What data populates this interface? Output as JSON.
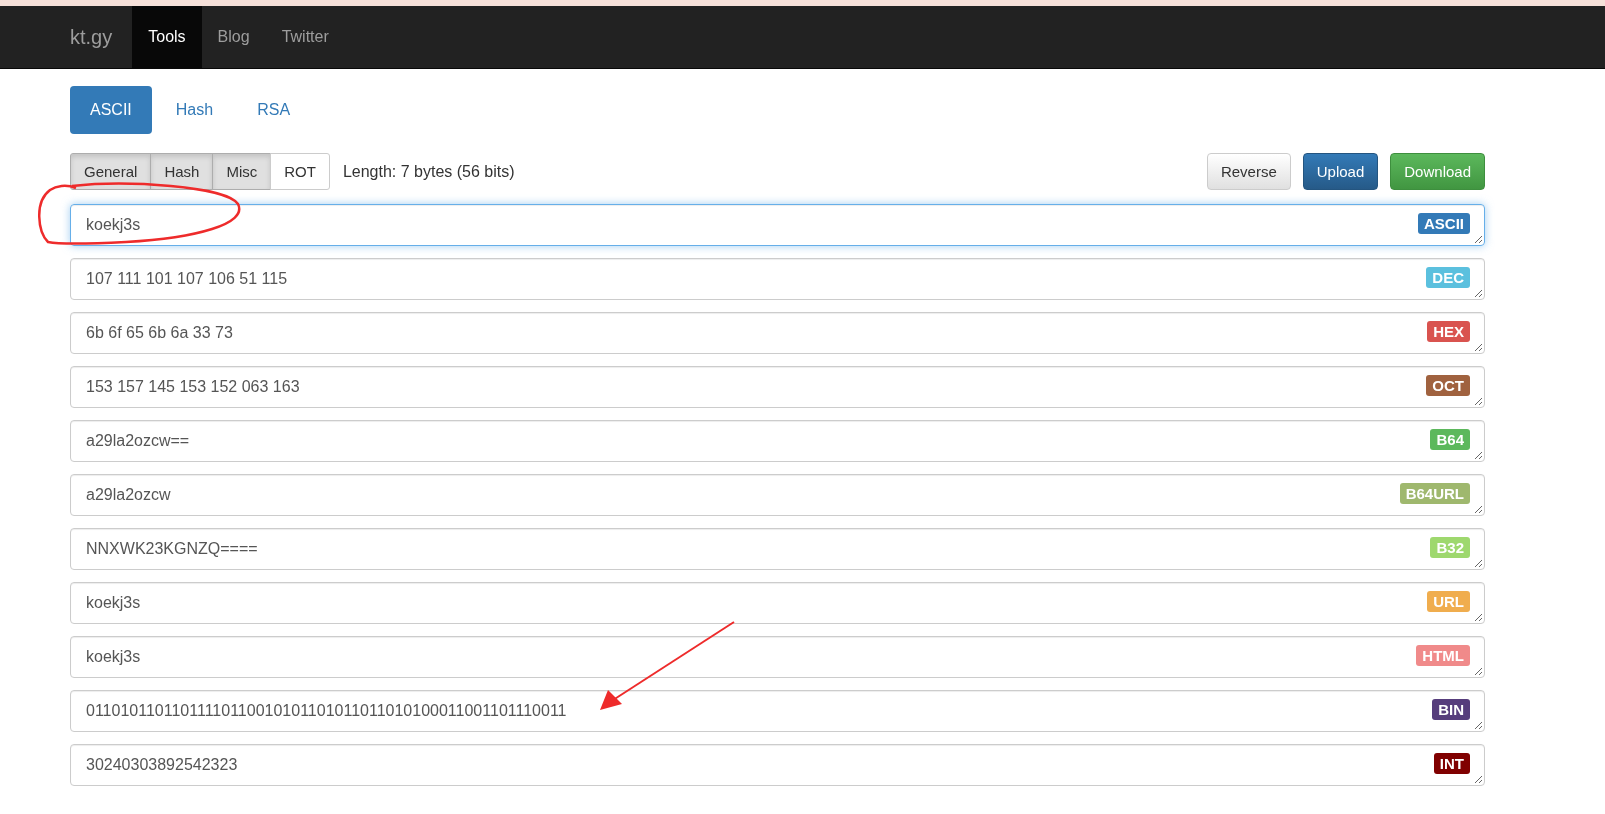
{
  "navbar": {
    "brand": "kt.gy",
    "items": [
      {
        "label": "Tools",
        "selected": true
      },
      {
        "label": "Blog",
        "selected": false
      },
      {
        "label": "Twitter",
        "selected": false
      }
    ]
  },
  "main_tabs": [
    {
      "label": "ASCII",
      "selected": true
    },
    {
      "label": "Hash",
      "selected": false
    },
    {
      "label": "RSA",
      "selected": false
    }
  ],
  "sub_tabs": [
    {
      "label": "General",
      "active": true
    },
    {
      "label": "Hash",
      "active": true
    },
    {
      "label": "Misc",
      "active": true
    },
    {
      "label": "ROT",
      "active": false
    }
  ],
  "length_text": "Length: 7 bytes (56 bits)",
  "buttons": [
    {
      "label": "Reverse",
      "kind": "default"
    },
    {
      "label": "Upload",
      "kind": "primary"
    },
    {
      "label": "Download",
      "kind": "success"
    }
  ],
  "fields": [
    {
      "value": "koekj3s",
      "badge": "ASCII",
      "color": "#337ab7",
      "focused": true
    },
    {
      "value": "107 111 101 107 106 51 115",
      "badge": "DEC",
      "color": "#5bc0de",
      "focused": false
    },
    {
      "value": "6b 6f 65 6b 6a 33 73",
      "badge": "HEX",
      "color": "#d9534f",
      "focused": false
    },
    {
      "value": "153 157 145 153 152 063 163",
      "badge": "OCT",
      "color": "#a0623f",
      "focused": false
    },
    {
      "value": "a29la2ozcw==",
      "badge": "B64",
      "color": "#5cb85c",
      "focused": false
    },
    {
      "value": "a29la2ozcw",
      "badge": "B64URL",
      "color": "#9fb86e",
      "focused": false
    },
    {
      "value": "NNXWK23KGNZQ====",
      "badge": "B32",
      "color": "#9ed86e",
      "focused": false
    },
    {
      "value": "koekj3s",
      "badge": "URL",
      "color": "#f0ad4e",
      "focused": false
    },
    {
      "value": "koekj3s",
      "badge": "HTML",
      "color": "#f08a8a",
      "focused": false
    },
    {
      "value": "01101011011011110110010101101011011010100011001101110011",
      "badge": "BIN",
      "color": "#563d7c",
      "focused": false
    },
    {
      "value": "30240303892542323",
      "badge": "INT",
      "color": "#800000",
      "focused": false
    }
  ]
}
